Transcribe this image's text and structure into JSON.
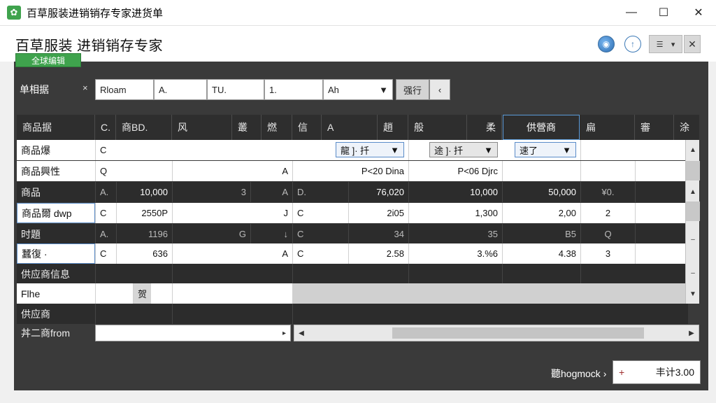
{
  "window": {
    "title": "百草服装进销销存专家进货单",
    "min": "—",
    "max": "☐",
    "close": "✕"
  },
  "app": {
    "title": "百草服装 进销销存专家",
    "tab": "全球编辑",
    "menu_glyph": "☰",
    "menu_caret": "▾",
    "close": "✕"
  },
  "filter": {
    "label": "单相据",
    "clear": "×",
    "fields": [
      "Rloam",
      "A.",
      "TU.",
      "1.",
      "Ah"
    ],
    "dropdown_caret": "▼",
    "button": "强行",
    "nav": "‹"
  },
  "grid": {
    "columns": [
      "商品据",
      "C.",
      "商BD.",
      "风",
      "叢",
      "燃",
      "信",
      "A",
      "趙",
      "般",
      "柔",
      "供營商",
      "扁",
      "審",
      "涂"
    ],
    "rows": [
      {
        "label": "商品爆",
        "a": "C",
        "dd1": "龍 ]· 扦",
        "dd2": "途 ]· 扦",
        "dd3": "速了"
      },
      {
        "label": "商品興性",
        "a": "Q",
        "b": "A",
        "c": "P<20 Dina",
        "d": "P<06 Djrc"
      },
      {
        "label": "商品",
        "a": "A.",
        "b": "10,000",
        "c": "3",
        "d": "A",
        "e": "D.",
        "f": "76,020",
        "g": "10,000",
        "h": "50,000",
        "i": "¥0."
      },
      {
        "label": "商品爾 dwp",
        "a": "C",
        "b": "2550P",
        "c": "J",
        "d": "C",
        "e": "2i05",
        "f": "1,300",
        "g": "2,00",
        "h": "2"
      },
      {
        "label": "时題",
        "a": "A.",
        "b": "1196",
        "c": "G",
        "d": "↓",
        "e": "C",
        "f": "34",
        "g": "35",
        "h": "B5",
        "i": "Q"
      },
      {
        "label": "蠶復 ·",
        "a": "C",
        "b": "636",
        "c": "A",
        "d": "C",
        "e": "2.58",
        "f": "3.%6",
        "g": "4.38",
        "h": "3"
      },
      {
        "label": "供应商信息"
      },
      {
        "label": "Flhe",
        "a": "贺"
      },
      {
        "label": "供应商"
      },
      {
        "label": "丼二商from",
        "arrow": "▸"
      }
    ]
  },
  "scroll": {
    "up": "▲",
    "down": "▼",
    "left": "◀",
    "right": "▶",
    "dash": "–"
  },
  "footer": {
    "label": "聽hogmock ›",
    "plus": "+",
    "total": "丰计3.00"
  }
}
